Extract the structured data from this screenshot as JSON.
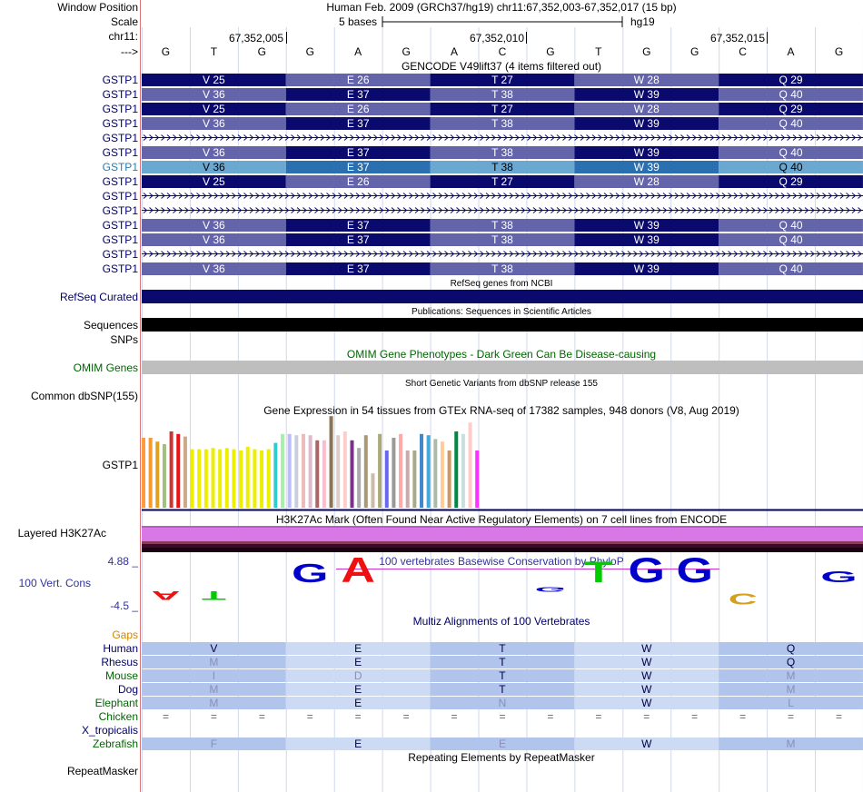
{
  "header": {
    "window_position_label": "Window Position",
    "window_position_value": "Human Feb. 2009 (GRCh37/hg19)   chr11:67,352,003-67,352,017 (15 bp)",
    "scale_label": "Scale",
    "scale_value": "5 bases",
    "scale_db": "hg19",
    "chrom_label": "chr11:",
    "strand_label": "--->",
    "ruler_ticks": [
      "67,352,005",
      "67,352,010",
      "67,352,015"
    ],
    "bases": [
      "G",
      "T",
      "G",
      "G",
      "A",
      "G",
      "A",
      "C",
      "G",
      "T",
      "G",
      "G",
      "C",
      "A",
      "G"
    ]
  },
  "tracks": {
    "gencode": {
      "title": "GENCODE V49lift37 (4 items filtered out)",
      "label": "GSTP1",
      "rows": [
        {
          "type": "a",
          "codons": [
            "V 25",
            "E 26",
            "T 27",
            "W 28",
            "Q 29"
          ]
        },
        {
          "type": "b",
          "codons": [
            "V 36",
            "E 37",
            "T 38",
            "W 39",
            "Q 40"
          ]
        },
        {
          "type": "a",
          "codons": [
            "V 25",
            "E 26",
            "T 27",
            "W 28",
            "Q 29"
          ]
        },
        {
          "type": "b",
          "codons": [
            "V 36",
            "E 37",
            "T 38",
            "W 39",
            "Q 40"
          ]
        },
        {
          "type": "intron",
          "codons": []
        },
        {
          "type": "b",
          "codons": [
            "V 36",
            "E 37",
            "T 38",
            "W 39",
            "Q 40"
          ]
        },
        {
          "type": "hl",
          "codons": [
            "V 36",
            "E 37",
            "T 38",
            "W 39",
            "Q 40"
          ]
        },
        {
          "type": "a",
          "codons": [
            "V 25",
            "E 26",
            "T 27",
            "W 28",
            "Q 29"
          ]
        },
        {
          "type": "intron",
          "codons": []
        },
        {
          "type": "intron",
          "codons": []
        },
        {
          "type": "b",
          "codons": [
            "V 36",
            "E 37",
            "T 38",
            "W 39",
            "Q 40"
          ]
        },
        {
          "type": "b",
          "codons": [
            "V 36",
            "E 37",
            "T 38",
            "W 39",
            "Q 40"
          ]
        },
        {
          "type": "intron",
          "codons": []
        },
        {
          "type": "c",
          "codons": [
            "V 36",
            "E 37",
            "T 38",
            "W 39",
            "Q 40"
          ]
        }
      ]
    },
    "refseq": {
      "title": "RefSeq genes from NCBI",
      "label": "RefSeq Curated"
    },
    "publications": {
      "title": "Publications: Sequences in Scientific Articles",
      "label": "Sequences"
    },
    "snps": {
      "label": "SNPs"
    },
    "omim": {
      "title": "OMIM Gene Phenotypes - Dark Green Can Be Disease-causing",
      "label": "OMIM Genes"
    },
    "dbsnp": {
      "title": "Short Genetic Variants from dbSNP release 155",
      "label": "Common dbSNP(155)"
    },
    "gtex": {
      "title": "Gene Expression in 54 tissues from GTEx RNA-seq of 17382 samples, 948 donors (V8, Aug 2019)",
      "label": "GSTP1",
      "bars": [
        {
          "h": 0.55,
          "c": "#ff9a3d"
        },
        {
          "h": 0.55,
          "c": "#f59a30"
        },
        {
          "h": 0.52,
          "c": "#e0a020"
        },
        {
          "h": 0.5,
          "c": "#a0c080"
        },
        {
          "h": 0.6,
          "c": "#cc3333"
        },
        {
          "h": 0.58,
          "c": "#ee1111"
        },
        {
          "h": 0.56,
          "c": "#ccaa88"
        },
        {
          "h": 0.46,
          "c": "#eeee00"
        },
        {
          "h": 0.46,
          "c": "#eeee00"
        },
        {
          "h": 0.46,
          "c": "#eeee00"
        },
        {
          "h": 0.47,
          "c": "#eeee00"
        },
        {
          "h": 0.46,
          "c": "#eeee00"
        },
        {
          "h": 0.47,
          "c": "#eeee00"
        },
        {
          "h": 0.46,
          "c": "#eeee00"
        },
        {
          "h": 0.45,
          "c": "#eeee00"
        },
        {
          "h": 0.48,
          "c": "#eeee00"
        },
        {
          "h": 0.46,
          "c": "#eeee00"
        },
        {
          "h": 0.45,
          "c": "#eeee00"
        },
        {
          "h": 0.46,
          "c": "#eeee00"
        },
        {
          "h": 0.51,
          "c": "#33cccc"
        },
        {
          "h": 0.58,
          "c": "#aaeeaa"
        },
        {
          "h": 0.58,
          "c": "#bbbbff"
        },
        {
          "h": 0.57,
          "c": "#ccccdd"
        },
        {
          "h": 0.58,
          "c": "#eebbbb"
        },
        {
          "h": 0.57,
          "c": "#ddbbcc"
        },
        {
          "h": 0.53,
          "c": "#aa6666"
        },
        {
          "h": 0.53,
          "c": "#ffbbcc"
        },
        {
          "h": 0.72,
          "c": "#8b7355"
        },
        {
          "h": 0.57,
          "c": "#ddcccc"
        },
        {
          "h": 0.6,
          "c": "#ffcccc"
        },
        {
          "h": 0.53,
          "c": "#773388"
        },
        {
          "h": 0.47,
          "c": "#aaaaaa"
        },
        {
          "h": 0.57,
          "c": "#aa9977"
        },
        {
          "h": 0.27,
          "c": "#ccbbaa"
        },
        {
          "h": 0.58,
          "c": "#aaaa77"
        },
        {
          "h": 0.45,
          "c": "#6666ee"
        },
        {
          "h": 0.55,
          "c": "#999999"
        },
        {
          "h": 0.58,
          "c": "#ffaaaa"
        },
        {
          "h": 0.45,
          "c": "#ccaaaa"
        },
        {
          "h": 0.45,
          "c": "#aaaa88"
        },
        {
          "h": 0.58,
          "c": "#4488cc"
        },
        {
          "h": 0.57,
          "c": "#44aadd"
        },
        {
          "h": 0.54,
          "c": "#aabbaa"
        },
        {
          "h": 0.52,
          "c": "#ffcc99"
        },
        {
          "h": 0.45,
          "c": "#cc9966"
        },
        {
          "h": 0.6,
          "c": "#008844"
        },
        {
          "h": 0.58,
          "c": "#ccdddd"
        },
        {
          "h": 0.67,
          "c": "#ffcccc"
        },
        {
          "h": 0.45,
          "c": "#ff33ff"
        }
      ]
    },
    "h3k27ac": {
      "title": "H3K27Ac Mark (Often Found Near Active Regulatory Elements) on 7 cell lines from ENCODE",
      "label": "Layered H3K27Ac"
    },
    "phylop": {
      "title": "100 vertebrates Basewise Conservation by PhyloP",
      "label": "100 Vert. Cons",
      "ymax_label": "4.88 _",
      "ymin_label": "-4.5 _",
      "logo": [
        {
          "b": "A",
          "s": -0.35
        },
        {
          "b": "T",
          "s": -0.35
        },
        {
          "b": "G",
          "s": 0
        },
        {
          "b": "G",
          "s": 0.75
        },
        {
          "b": "A",
          "s": 1.0
        },
        {
          "b": "G",
          "s": 0
        },
        {
          "b": "A",
          "s": 0
        },
        {
          "b": "C",
          "s": 0
        },
        {
          "b": "G",
          "s": -0.2
        },
        {
          "b": "T",
          "s": 0.85
        },
        {
          "b": "G",
          "s": 1.0
        },
        {
          "b": "G",
          "s": 1.0
        },
        {
          "b": "C",
          "s": -0.45
        },
        {
          "b": "A",
          "s": 0
        },
        {
          "b": "G",
          "s": 0.45
        }
      ]
    },
    "multiz": {
      "title": "Multiz Alignments of 100 Vertebrates",
      "gaps_label": "Gaps",
      "species": [
        {
          "name": "Human",
          "color": "#000066",
          "aa": [
            "V",
            "E",
            "T",
            "W",
            "Q"
          ],
          "dim": [
            false,
            false,
            false,
            false,
            false
          ]
        },
        {
          "name": "Rhesus",
          "color": "#000066",
          "aa": [
            "M",
            "E",
            "T",
            "W",
            "Q"
          ],
          "dim": [
            true,
            false,
            false,
            false,
            false
          ]
        },
        {
          "name": "Mouse",
          "color": "#006600",
          "aa": [
            "I",
            "D",
            "T",
            "W",
            "M"
          ],
          "dim": [
            true,
            true,
            false,
            false,
            true
          ]
        },
        {
          "name": "Dog",
          "color": "#000066",
          "aa": [
            "M",
            "E",
            "T",
            "W",
            "M"
          ],
          "dim": [
            true,
            false,
            false,
            false,
            true
          ]
        },
        {
          "name": "Elephant",
          "color": "#006600",
          "aa": [
            "M",
            "E",
            "N",
            "W",
            "L"
          ],
          "dim": [
            true,
            false,
            true,
            false,
            true
          ]
        },
        {
          "name": "Chicken",
          "color": "#006600",
          "aa": [],
          "dim": []
        },
        {
          "name": "X_tropicalis",
          "color": "#000066",
          "aa": [],
          "dim": []
        },
        {
          "name": "Zebrafish",
          "color": "#006600",
          "aa": [
            "F",
            "E",
            "E",
            "W",
            "M"
          ],
          "dim": [
            true,
            false,
            true,
            false,
            true
          ]
        }
      ],
      "gap_char": "="
    },
    "repeatmasker": {
      "title": "Repeating Elements by RepeatMasker",
      "label": "RepeatMasker"
    }
  },
  "colors": {
    "codon_a": "#0a0a6e",
    "codon_b": "#6464aa",
    "codon_hl_a": "#6aa8d2",
    "codon_hl_b": "#2a6fb0",
    "label_blue": "#000066",
    "omim_green": "#006600",
    "omim_bar": "#bebebe",
    "gaps_orange": "#cc8800",
    "phylop_blue": "#333399"
  }
}
